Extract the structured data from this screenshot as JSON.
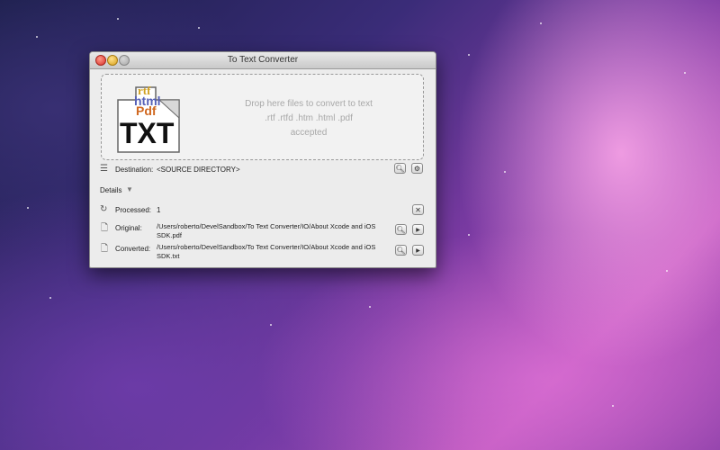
{
  "window": {
    "title": "To Text Converter"
  },
  "logo": {
    "lines": [
      "rtf",
      "html",
      "Pdf",
      "TXT"
    ]
  },
  "dropzone": {
    "line1": "Drop here files to convert to text",
    "line2": ".rtf   .rtfd   .htm   .html   .pdf",
    "line3": "accepted"
  },
  "destination": {
    "label": "Destination:",
    "value": "<SOURCE DIRECTORY>"
  },
  "details": {
    "label": "Details"
  },
  "processed": {
    "label": "Processed:",
    "value": "1"
  },
  "original": {
    "label": "Original:",
    "path_line1": "/Users/roberto/DevelSandbox/To Text Converter/IO/About Xcode and iOS",
    "path_line2": "SDK.pdf"
  },
  "converted": {
    "label": "Converted:",
    "path_line1": "/Users/roberto/DevelSandbox/To Text Converter/IO/About Xcode and iOS",
    "path_line2": "SDK.txt"
  },
  "icons": {
    "search": "magnifier-icon",
    "settings": "gear-icon",
    "close": "x-icon",
    "play": "play-icon"
  }
}
